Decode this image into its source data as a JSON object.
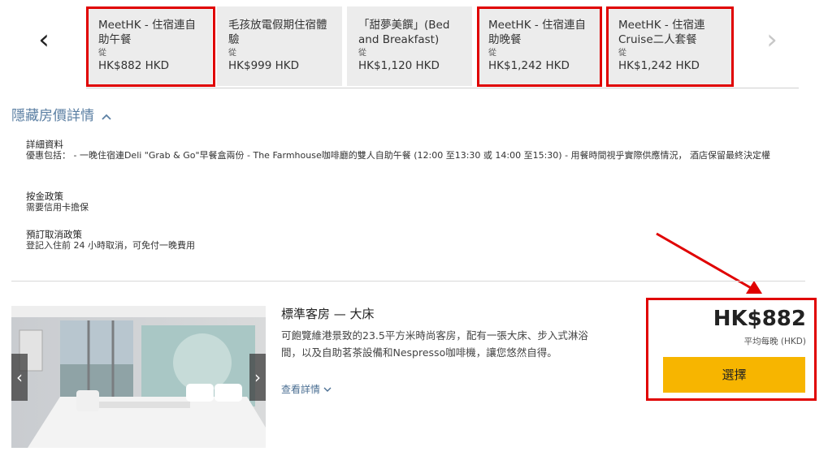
{
  "carousel": {
    "prev_icon": "‹",
    "next_icon": "›",
    "cards": [
      {
        "title": "MeetHK - 住宿連自助午餐",
        "from": "從",
        "price": "HK$882 HKD"
      },
      {
        "title": "毛孩放電假期住宿體驗",
        "from": "從",
        "price": "HK$999 HKD"
      },
      {
        "title": "「甜夢美饌」(Bed and Breakfast)",
        "from": "從",
        "price": "HK$1,120 HKD"
      },
      {
        "title": "MeetHK - 住宿連自助晚餐",
        "from": "從",
        "price": "HK$1,242 HKD"
      },
      {
        "title": "MeetHK - 住宿連Cruise二人套餐",
        "from": "從",
        "price": "HK$1,242 HKD"
      }
    ]
  },
  "rate_details": {
    "toggle_label": "隱藏房價詳情",
    "toggle_icon": "^",
    "details_heading": "詳細資料",
    "details_text": "優惠包括： - 一晚住宿連Deli \"Grab & Go\"早餐盒兩份 - The Farmhouse咖啡廳的雙人自助午餐 (12:00 至13:30 或 14:00 至15:30) - 用餐時間視乎實際供應情況， 酒店保留最終決定權",
    "deposit_heading": "按金政策",
    "deposit_text": "需要信用卡擔保",
    "cancel_heading": "預訂取消政策",
    "cancel_text": "登記入住前 24 小時取消，可免付一晚費用"
  },
  "room": {
    "title": "標準客房 — 大床",
    "description": "可飽覽維港景致的23.5平方米時尚客房，配有一張大床、步入式淋浴間，以及自助茗茶設備和Nespresso咖啡機，讓您悠然自得。",
    "more_label": "查看詳情",
    "more_icon": "⌄",
    "img_prev": "‹",
    "img_next": "›",
    "price": "HK$882",
    "per_night": "平均每晚 (HKD)",
    "select_label": "選擇"
  },
  "colors": {
    "highlight": "#e00000",
    "select_button": "#f7b500",
    "link": "#5b7fa3"
  }
}
